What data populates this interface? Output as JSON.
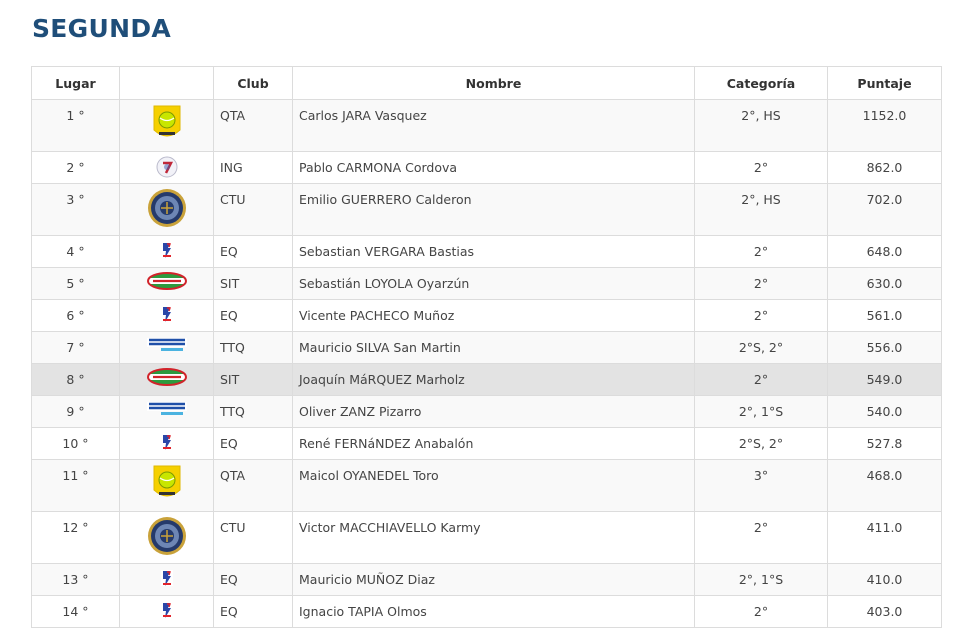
{
  "page": {
    "title": "SEGUNDA"
  },
  "table": {
    "headers": [
      "Lugar",
      "",
      "Club",
      "Nombre",
      "Categoría",
      "Puntaje"
    ],
    "rows": [
      {
        "lugar": "1 °",
        "club": "QTA",
        "nombre": "Carlos JARA Vasquez",
        "categoria": "2°, HS",
        "puntaje": "1152.0",
        "logo": "qta-logo-icon",
        "size": "tall"
      },
      {
        "lugar": "2 °",
        "club": "ING",
        "nombre": "Pablo CARMONA Cordova",
        "categoria": "2°",
        "puntaje": "862.0",
        "logo": "ing-logo-icon",
        "size": "short"
      },
      {
        "lugar": "3 °",
        "club": "CTU",
        "nombre": "Emilio GUERRERO Calderon",
        "categoria": "2°, HS",
        "puntaje": "702.0",
        "logo": "ctu-logo-icon",
        "size": "tall"
      },
      {
        "lugar": "4 °",
        "club": "EQ",
        "nombre": "Sebastian VERGARA Bastias",
        "categoria": "2°",
        "puntaje": "648.0",
        "logo": "eq-logo-icon",
        "size": "short"
      },
      {
        "lugar": "5 °",
        "club": "SIT",
        "nombre": "Sebastián LOYOLA Oyarzún",
        "categoria": "2°",
        "puntaje": "630.0",
        "logo": "sit-logo-icon",
        "size": "short"
      },
      {
        "lugar": "6 °",
        "club": "EQ",
        "nombre": "Vicente PACHECO Muñoz",
        "categoria": "2°",
        "puntaje": "561.0",
        "logo": "eq-logo-icon",
        "size": "short"
      },
      {
        "lugar": "7 °",
        "club": "TTQ",
        "nombre": "Mauricio SILVA San Martin",
        "categoria": "2°S, 2°",
        "puntaje": "556.0",
        "logo": "ttq-logo-icon",
        "size": "short"
      },
      {
        "lugar": "8 °",
        "club": "SIT",
        "nombre": "Joaquín MáRQUEZ Marholz",
        "categoria": "2°",
        "puntaje": "549.0",
        "logo": "sit-logo-icon",
        "size": "short",
        "highlight": true
      },
      {
        "lugar": "9 °",
        "club": "TTQ",
        "nombre": "Oliver ZANZ Pizarro",
        "categoria": "2°, 1°S",
        "puntaje": "540.0",
        "logo": "ttq-logo-icon",
        "size": "short"
      },
      {
        "lugar": "10 °",
        "club": "EQ",
        "nombre": "René FERNáNDEZ Anabalón",
        "categoria": "2°S, 2°",
        "puntaje": "527.8",
        "logo": "eq-logo-icon",
        "size": "short"
      },
      {
        "lugar": "11 °",
        "club": "QTA",
        "nombre": "Maicol OYANEDEL Toro",
        "categoria": "3°",
        "puntaje": "468.0",
        "logo": "qta-logo-icon",
        "size": "tall"
      },
      {
        "lugar": "12 °",
        "club": "CTU",
        "nombre": "Victor MACCHIAVELLO Karmy",
        "categoria": "2°",
        "puntaje": "411.0",
        "logo": "ctu-logo-icon",
        "size": "tall"
      },
      {
        "lugar": "13 °",
        "club": "EQ",
        "nombre": "Mauricio MUÑOZ Diaz",
        "categoria": "2°, 1°S",
        "puntaje": "410.0",
        "logo": "eq-logo-icon",
        "size": "short"
      },
      {
        "lugar": "14 °",
        "club": "EQ",
        "nombre": "Ignacio TAPIA Olmos",
        "categoria": "2°",
        "puntaje": "403.0",
        "logo": "eq-logo-icon",
        "size": "short"
      }
    ]
  },
  "colors": {
    "title": "#1f4e79",
    "highlight_row": "#e3e3e3",
    "border": "#dcdcdc"
  }
}
